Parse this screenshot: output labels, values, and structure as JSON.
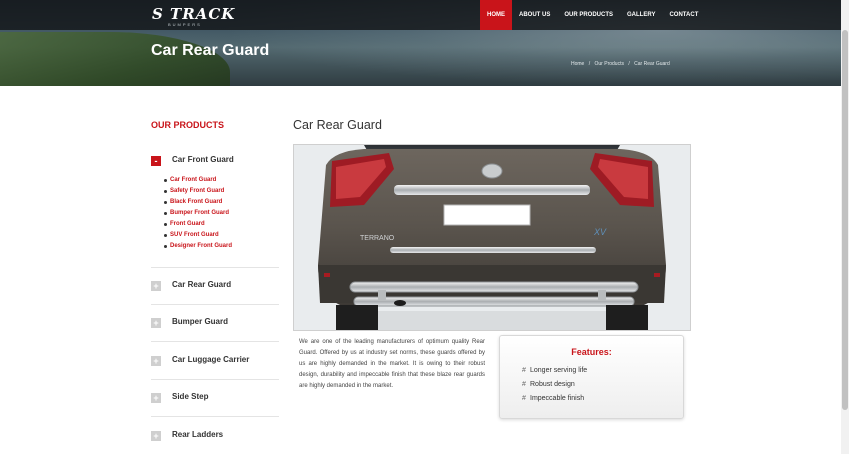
{
  "header": {
    "logo": "S TRACK",
    "logo_sub": "BUMPERS",
    "title": "Car Rear Guard",
    "nav": [
      {
        "label": "HOME",
        "active": true
      },
      {
        "label": "ABOUT US",
        "active": false
      },
      {
        "label": "OUR PRODUCTS",
        "active": false
      },
      {
        "label": "GALLERY",
        "active": false
      },
      {
        "label": "CONTACT",
        "active": false
      }
    ],
    "breadcrumb": [
      "Home",
      "/",
      "Our Products",
      "/",
      "Car Rear Guard"
    ]
  },
  "sidebar": {
    "heading": "OUR PRODUCTS",
    "categories": [
      {
        "label": "Car Front Guard",
        "toggle": "-"
      },
      {
        "label": "Car Rear Guard",
        "toggle": "+"
      },
      {
        "label": "Bumper Guard",
        "toggle": "+"
      },
      {
        "label": "Car Luggage Carrier",
        "toggle": "+"
      },
      {
        "label": "Side Step",
        "toggle": "+"
      },
      {
        "label": "Rear Ladders",
        "toggle": "+"
      }
    ],
    "subitems": [
      "Car Front Guard",
      "Safety Front Guard",
      "Black Front Guard",
      "Bumper Front Guard",
      "Front Guard",
      "SUV Front Guard",
      "Designer Front Guard"
    ]
  },
  "main": {
    "title": "Car Rear Guard",
    "description": "We are one of the leading manufacturers of optimum quality Rear Guard. Offered by us at industry set norms, these guards offered by us are highly demanded in the market. It is owing to their robust design, durability and impeccable finish that these blaze rear guards are highly demanded in the market.",
    "features_title": "Features:",
    "features": [
      "Longer serving life",
      "Robust design",
      "Impeccable finish"
    ],
    "photo_badge": "TERRANO",
    "photo_model": "XV"
  },
  "colors": {
    "accent": "#c9141a",
    "text": "#333333"
  }
}
